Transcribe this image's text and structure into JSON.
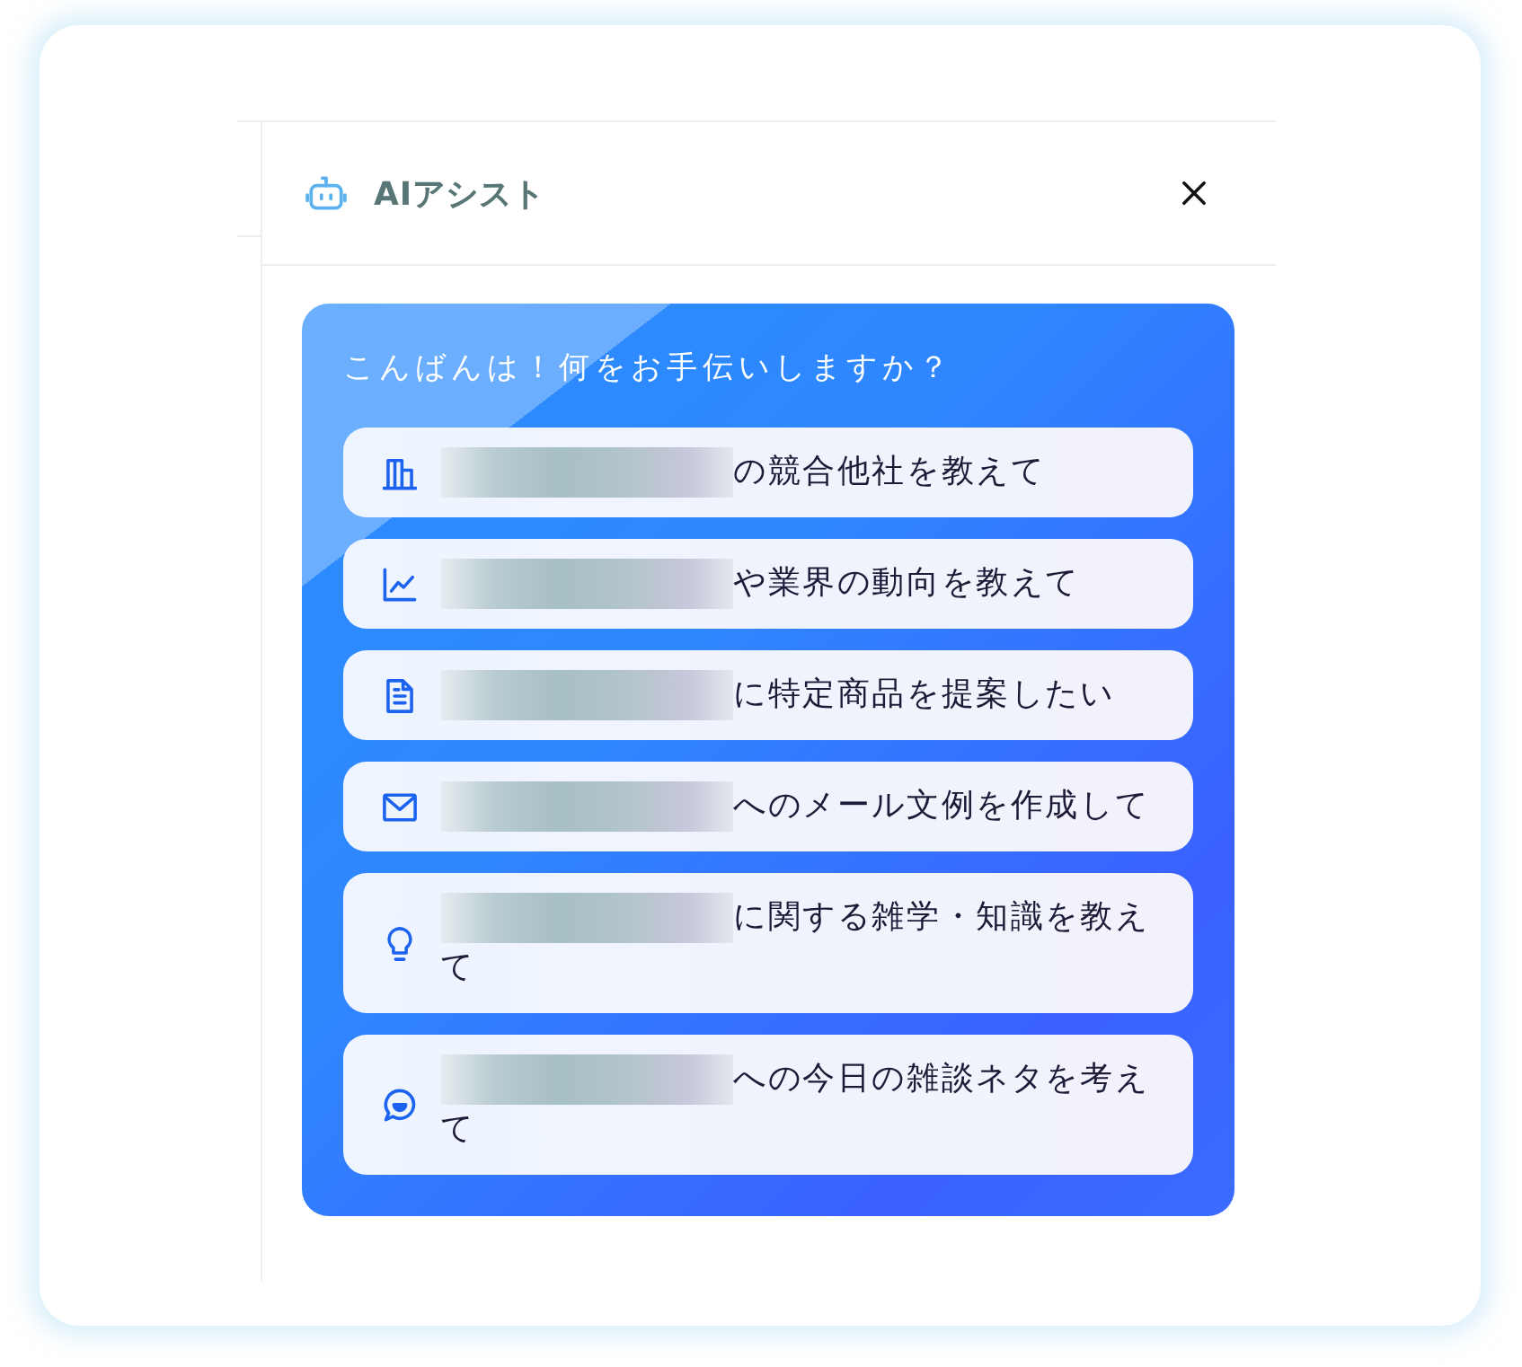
{
  "panel": {
    "title": "AIアシスト"
  },
  "assistant": {
    "greeting": "こんばんは！何をお手伝いしますか？",
    "suggestions": [
      {
        "kind": "competitors",
        "redacted": true,
        "text": "の競合他社を教えて"
      },
      {
        "kind": "trends",
        "redacted": true,
        "text": "や業界の動向を教えて"
      },
      {
        "kind": "proposal",
        "redacted": true,
        "text": "に特定商品を提案したい"
      },
      {
        "kind": "email",
        "redacted": true,
        "text": "へのメール文例を作成して"
      },
      {
        "kind": "trivia",
        "redacted": true,
        "text": "に関する雑学・知識を教えて"
      },
      {
        "kind": "smalltalk",
        "redacted": true,
        "text": "への今日の雑談ネタを考えて"
      }
    ]
  }
}
